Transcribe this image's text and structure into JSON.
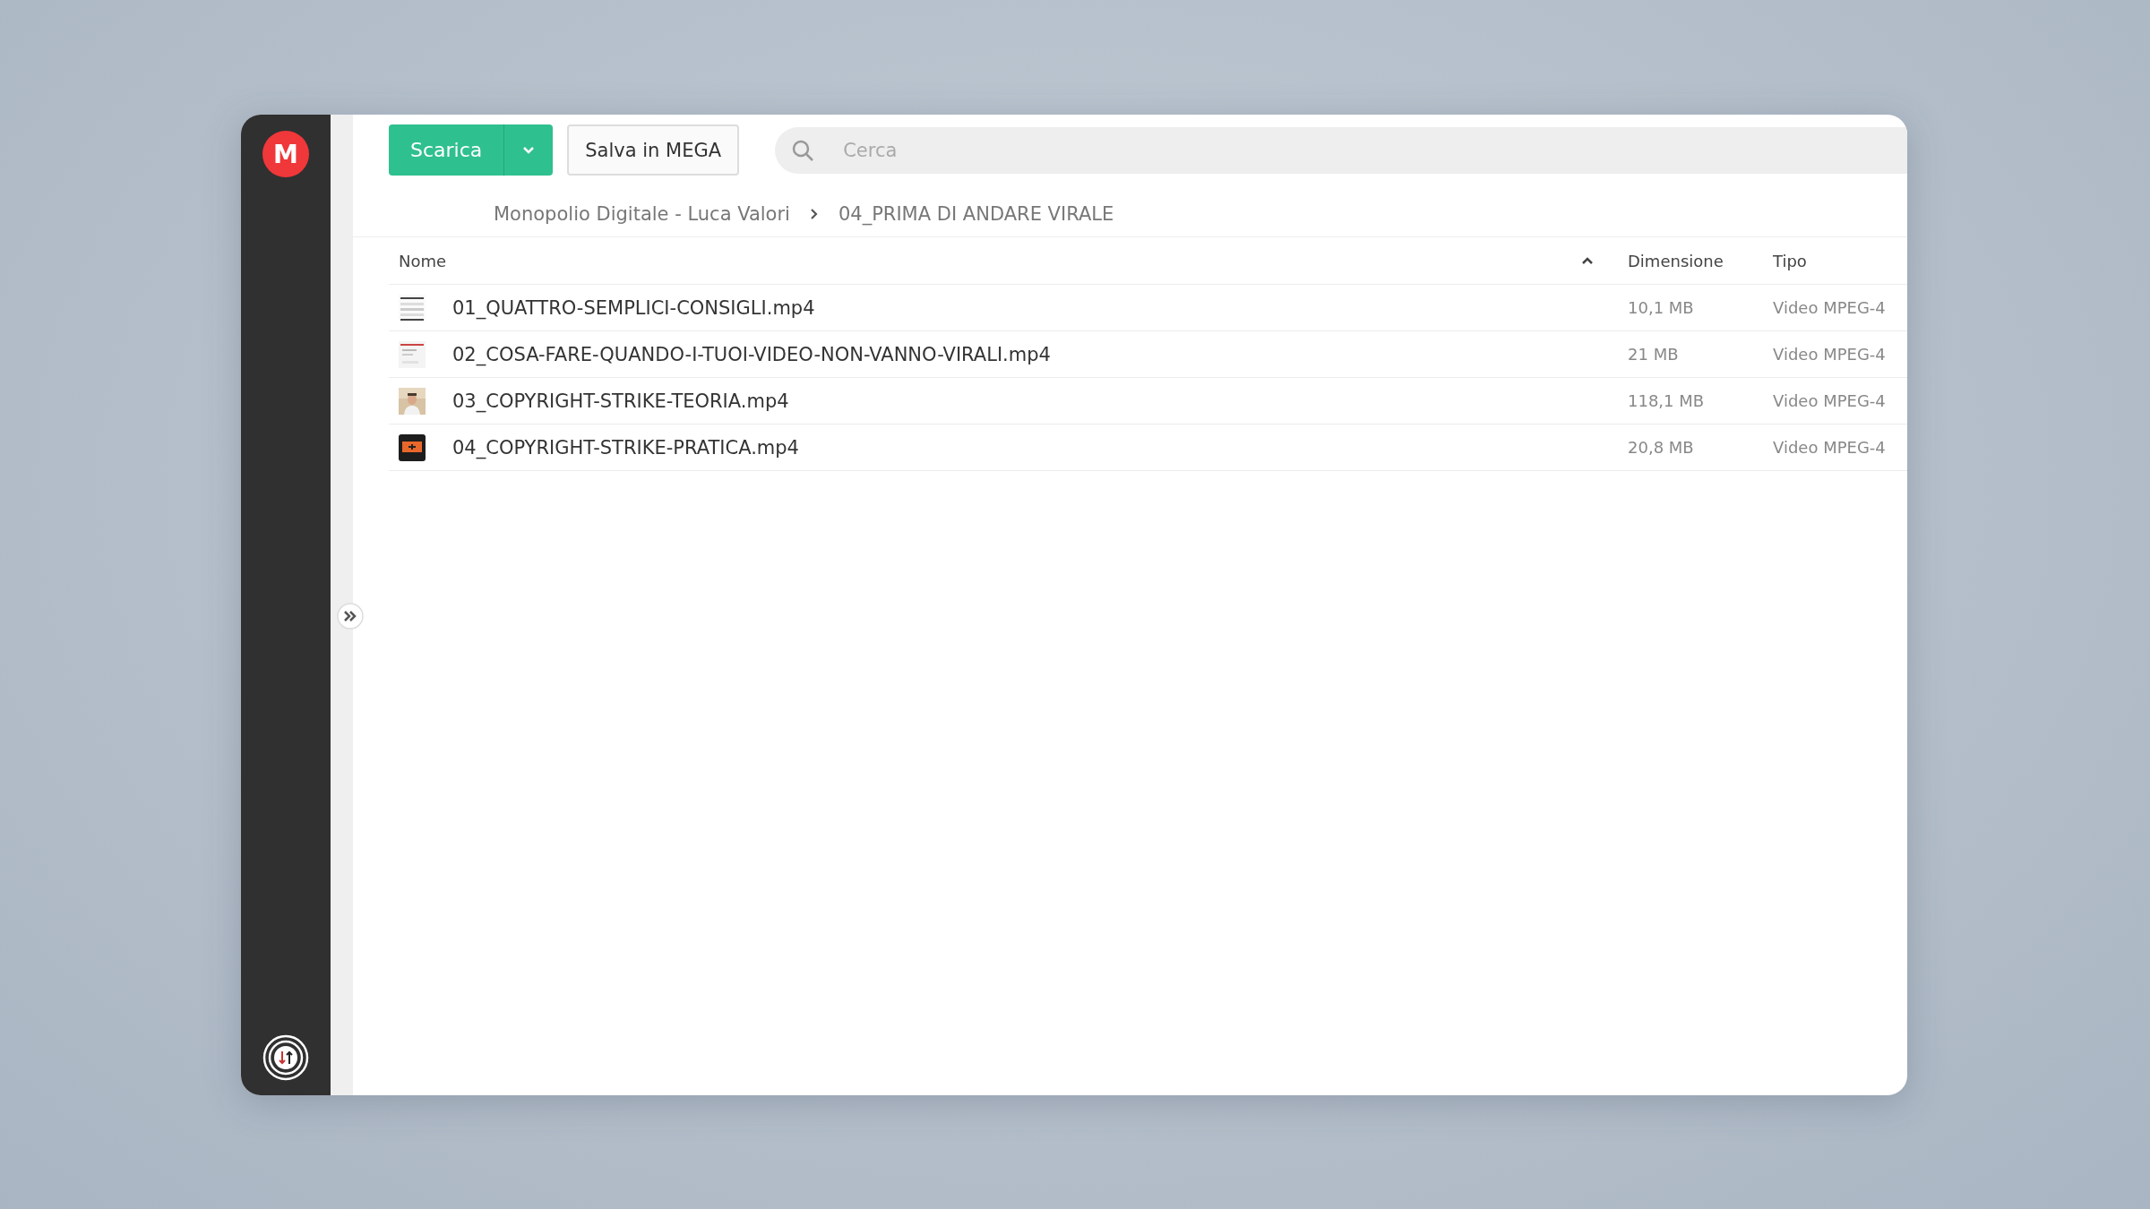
{
  "sidebar": {
    "logo": "M"
  },
  "toolbar": {
    "download_button": "Scarica",
    "save_button": "Salva in MEGA",
    "search": {
      "placeholder": "Cerca"
    }
  },
  "breadcrumb": [
    "Monopolio Digitale - Luca Valori",
    "04_PRIMA DI ANDARE VIRALE"
  ],
  "table": {
    "columns": [
      {
        "label": "Nome",
        "sort_ascending": true
      },
      {
        "label": "Dimensione"
      },
      {
        "label": "Tipo"
      }
    ],
    "rows": [
      {
        "name": "01_QUATTRO-SEMPLICI-CONSIGLI.mp4",
        "size": "10,1 MB",
        "type": "Video MPEG-4"
      },
      {
        "name": "02_COSA-FARE-QUANDO-I-TUOI-VIDEO-NON-VANNO-VIRALI.mp4",
        "size": "21 MB",
        "type": "Video MPEG-4"
      },
      {
        "name": "03_COPYRIGHT-STRIKE-TEORIA.mp4",
        "size": "118,1 MB",
        "type": "Video MPEG-4"
      },
      {
        "name": "04_COPYRIGHT-STRIKE-PRATICA.mp4",
        "size": "20,8 MB",
        "type": "Video MPEG-4"
      }
    ]
  }
}
